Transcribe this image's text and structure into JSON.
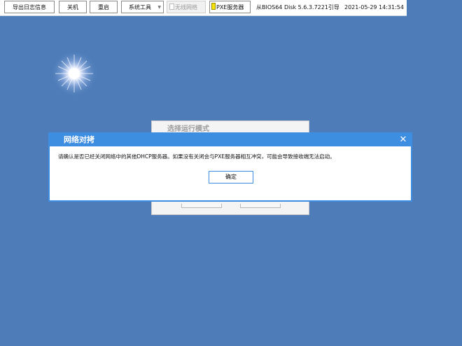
{
  "toolbar": {
    "export_log": "导出日志信息",
    "shutdown": "关机",
    "restart": "重启",
    "system_tools": "系统工具",
    "wireless": "无线网络",
    "pxe_server": "PXE服务器",
    "boot_source": "从BIOS64 Disk 5.6.3.7221引导",
    "datetime": "2021-05-29 14:31:54"
  },
  "background_window": {
    "title": "选择运行模式"
  },
  "dialog": {
    "title": "网络对拷",
    "message": "请确认是否已经关闭网络中的其他DHCP服务器。如果没有关闭会与PXE服务器相互冲突，可能会导致接收端无法启动。",
    "ok_label": "确定",
    "close_symbol": "✕"
  },
  "colors": {
    "desktop": "#4d7cb8",
    "dialog_accent": "#3d8de0",
    "pxe_indicator": "#f6e300"
  },
  "icons": {
    "dropdown": "chevron-down-icon",
    "close": "close-icon",
    "wireless_checkbox": "checkbox-icon",
    "pxe_status": "status-led-icon",
    "wallpaper_sun": "sun-icon"
  }
}
